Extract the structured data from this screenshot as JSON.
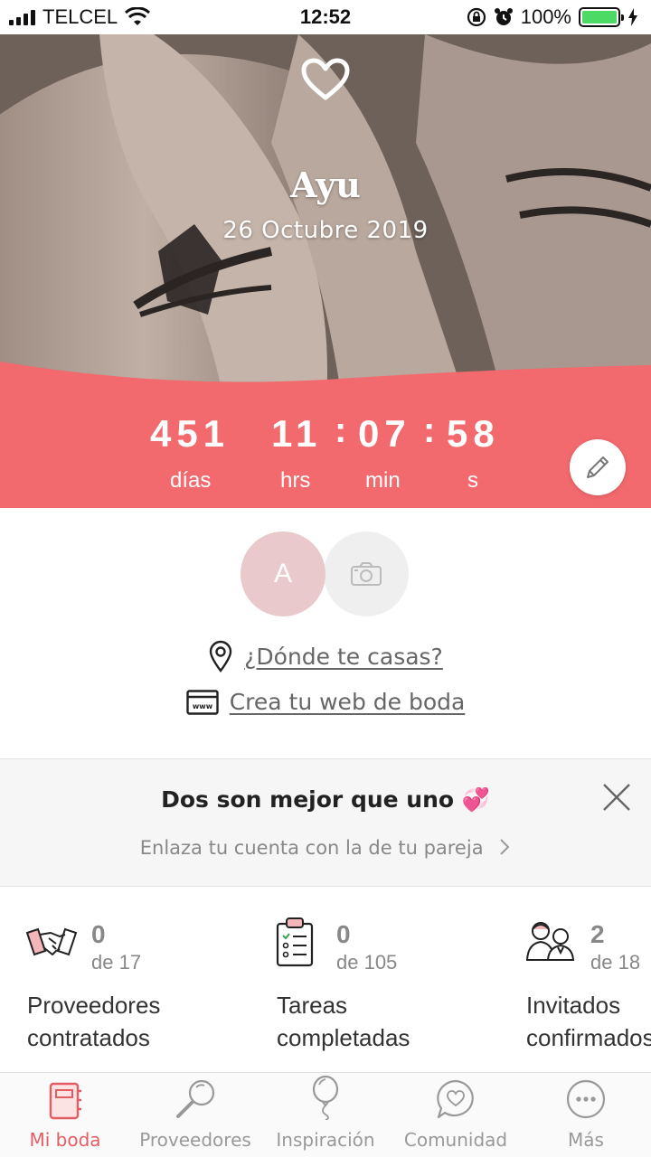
{
  "status_bar": {
    "carrier": "TELCEL",
    "time": "12:52",
    "battery": "100%"
  },
  "hero": {
    "name": "Ayu",
    "date": "26 Octubre 2019"
  },
  "countdown": {
    "days": "451",
    "hours": "11",
    "minutes": "07",
    "seconds": "58",
    "days_label": "días",
    "hours_label": "hrs",
    "minutes_label": "min",
    "seconds_label": "s"
  },
  "profile": {
    "avatar_initial": "A",
    "where_link": "¿Dónde te casas?",
    "web_link": "Crea tu web de boda"
  },
  "partner_banner": {
    "title": "Dos son mejor que uno 💞",
    "subtitle": "Enlaza tu cuenta con la de tu pareja"
  },
  "stats": [
    {
      "value": "0",
      "of": "de 17",
      "label_line1": "Proveedores",
      "label_line2": "contratados"
    },
    {
      "value": "0",
      "of": "de 105",
      "label_line1": "Tareas",
      "label_line2": "completadas"
    },
    {
      "value": "2",
      "of": "de 18",
      "label_line1": "Invitados",
      "label_line2": "confirmados"
    }
  ],
  "tabs": [
    {
      "label": "Mi boda",
      "icon": "notebook-icon",
      "active": true
    },
    {
      "label": "Proveedores",
      "icon": "magnifier-icon"
    },
    {
      "label": "Inspiración",
      "icon": "balloon-icon"
    },
    {
      "label": "Comunidad",
      "icon": "chat-heart-icon"
    },
    {
      "label": "Más",
      "icon": "more-dots-icon"
    }
  ],
  "colors": {
    "accent": "#f2696e",
    "tab_active": "#e45d62"
  }
}
